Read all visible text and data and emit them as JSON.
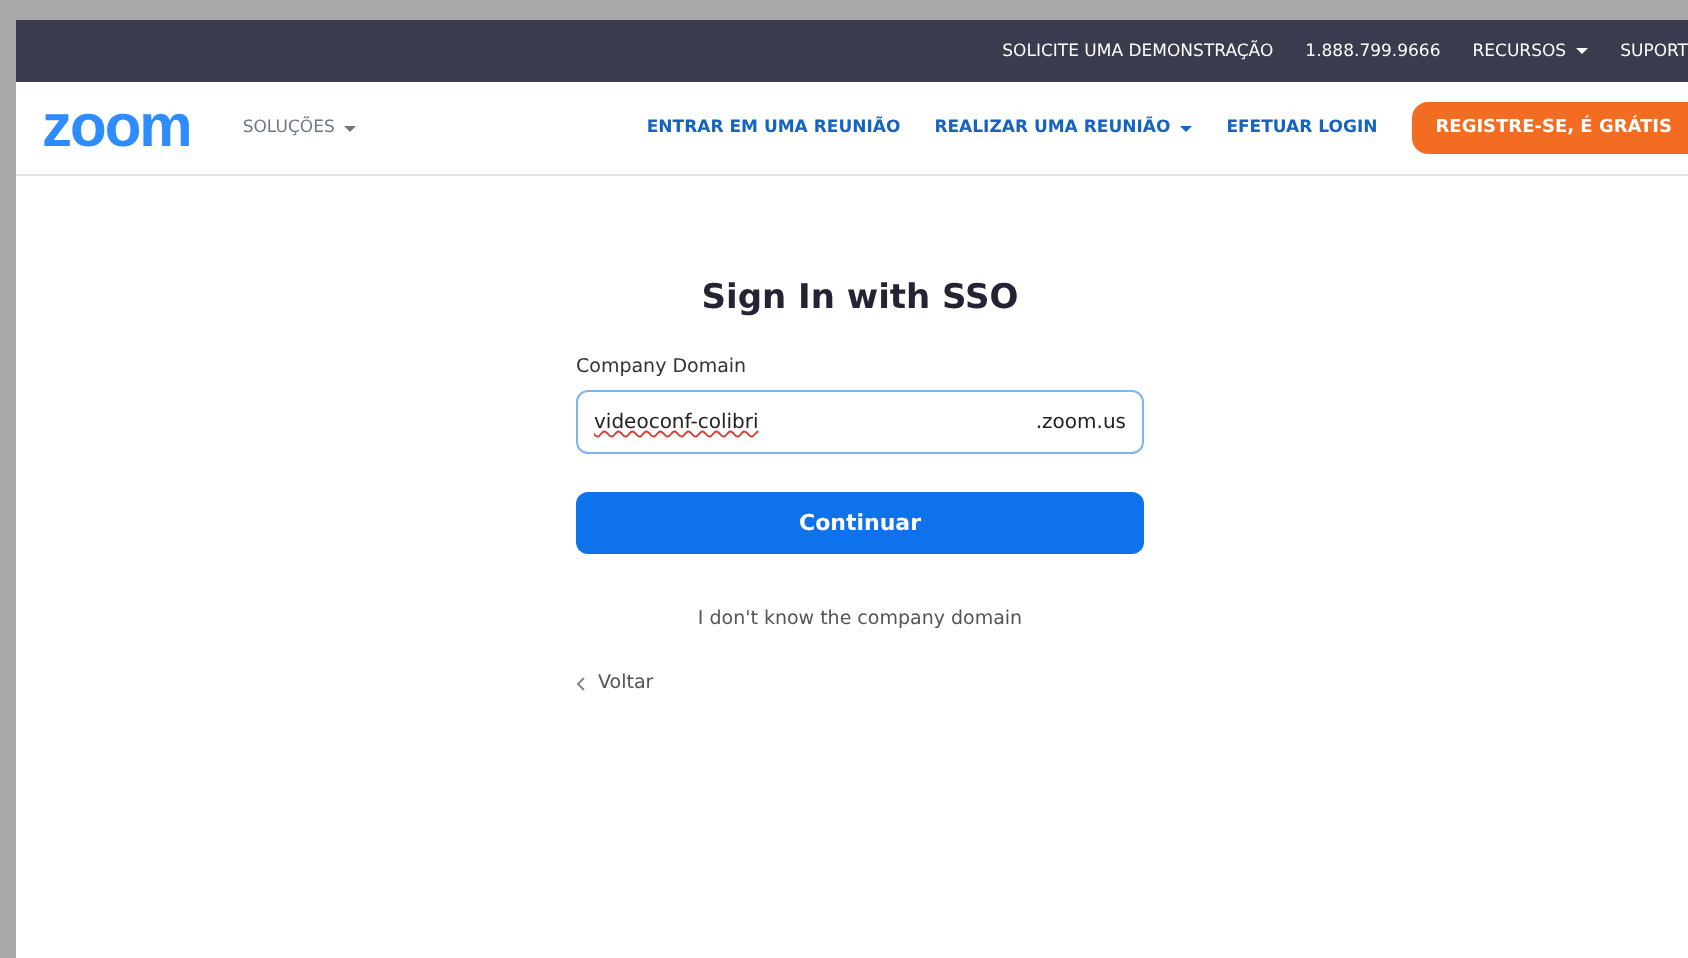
{
  "top_bar": {
    "links": [
      {
        "label": "SOLICITE UMA DEMONSTRAÇÃO",
        "dropdown": false
      },
      {
        "label": "1.888.799.9666",
        "dropdown": false
      },
      {
        "label": "RECURSOS",
        "dropdown": true
      },
      {
        "label": "SUPORT",
        "dropdown": false
      }
    ]
  },
  "nav": {
    "logo": "zoom",
    "solutions": {
      "label": "SOLUÇÕES",
      "dropdown": true
    },
    "links": [
      {
        "label": "ENTRAR EM UMA REUNIÃO",
        "dropdown": false
      },
      {
        "label": "REALIZAR UMA REUNIÃO",
        "dropdown": true
      },
      {
        "label": "EFETUAR LOGIN",
        "dropdown": false
      }
    ],
    "signup_button": "REGISTRE-SE, É GRÁTIS"
  },
  "form": {
    "title": "Sign In with SSO",
    "field_label": "Company Domain",
    "value": "videoconf-colibri",
    "suffix": ".zoom.us",
    "submit_button": "Continuar",
    "help_link": "I don't know the company domain",
    "back_link": "Voltar"
  }
}
